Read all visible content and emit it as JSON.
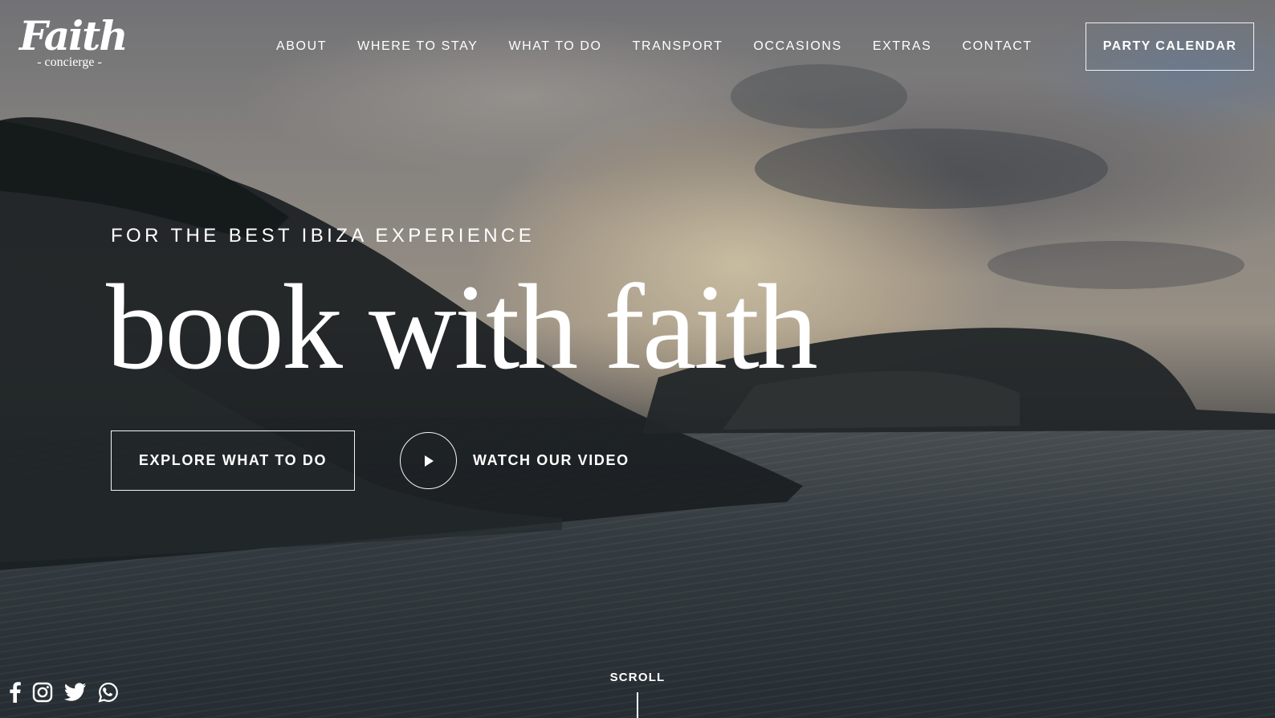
{
  "brand": {
    "logo_script": "Faith",
    "logo_sub": "- concierge -"
  },
  "nav": {
    "items": [
      {
        "label": "ABOUT"
      },
      {
        "label": "WHERE TO STAY"
      },
      {
        "label": "WHAT TO DO"
      },
      {
        "label": "TRANSPORT"
      },
      {
        "label": "OCCASIONS"
      },
      {
        "label": "EXTRAS"
      },
      {
        "label": "CONTACT"
      }
    ],
    "cta_label": "PARTY CALENDAR"
  },
  "hero": {
    "eyebrow": "FOR THE BEST IBIZA EXPERIENCE",
    "headline": "book with faith",
    "explore_label": "EXPLORE WHAT TO DO",
    "video_label": "WATCH OUR VIDEO"
  },
  "social": {
    "icons": [
      "facebook-icon",
      "instagram-icon",
      "twitter-icon",
      "whatsapp-icon"
    ]
  },
  "scroll": {
    "label": "SCROLL"
  },
  "colors": {
    "text": "#ffffff",
    "overlay": "#14161a"
  }
}
